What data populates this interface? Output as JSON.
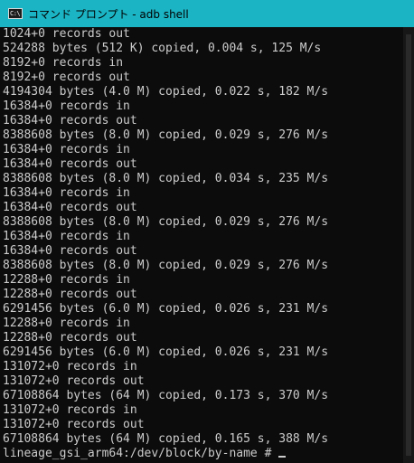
{
  "window": {
    "title": "コマンド プロンプト - adb  shell",
    "icon": "cmd-console-icon",
    "icon_glyph": "C:\\"
  },
  "console": {
    "text_color": "#cccccc",
    "background": "#0c0c0c",
    "lines": [
      "1024+0 records out",
      "524288 bytes (512 K) copied, 0.004 s, 125 M/s",
      "8192+0 records in",
      "8192+0 records out",
      "4194304 bytes (4.0 M) copied, 0.022 s, 182 M/s",
      "16384+0 records in",
      "16384+0 records out",
      "8388608 bytes (8.0 M) copied, 0.029 s, 276 M/s",
      "16384+0 records in",
      "16384+0 records out",
      "8388608 bytes (8.0 M) copied, 0.034 s, 235 M/s",
      "16384+0 records in",
      "16384+0 records out",
      "8388608 bytes (8.0 M) copied, 0.029 s, 276 M/s",
      "16384+0 records in",
      "16384+0 records out",
      "8388608 bytes (8.0 M) copied, 0.029 s, 276 M/s",
      "12288+0 records in",
      "12288+0 records out",
      "6291456 bytes (6.0 M) copied, 0.026 s, 231 M/s",
      "12288+0 records in",
      "12288+0 records out",
      "6291456 bytes (6.0 M) copied, 0.026 s, 231 M/s",
      "131072+0 records in",
      "131072+0 records out",
      "67108864 bytes (64 M) copied, 0.173 s, 370 M/s",
      "131072+0 records in",
      "131072+0 records out",
      "67108864 bytes (64 M) copied, 0.165 s, 388 M/s"
    ],
    "prompt": "lineage_gsi_arm64:/dev/block/by-name # "
  }
}
